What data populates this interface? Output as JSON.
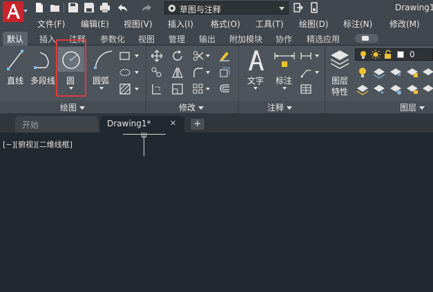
{
  "title_bar": {
    "workspace": "草图与注释",
    "document_title": "Drawing1"
  },
  "menu": {
    "items": [
      "文件(F)",
      "编辑(E)",
      "视图(V)",
      "插入(I)",
      "格式(O)",
      "工具(T)",
      "绘图(D)",
      "标注(N)",
      "修改(M)"
    ]
  },
  "ribbon_tabs": {
    "items": [
      "默认",
      "插入",
      "注释",
      "参数化",
      "视图",
      "管理",
      "输出",
      "附加模块",
      "协作",
      "精选应用"
    ],
    "active": "默认"
  },
  "draw_panel": {
    "line": "直线",
    "polyline": "多段线",
    "circle": "圆",
    "arc": "圆弧",
    "label": "绘图"
  },
  "modify_panel": {
    "label": "修改"
  },
  "annotation_panel": {
    "text": "文字",
    "dimension": "标注",
    "label": "注释"
  },
  "layers_panel": {
    "layer_properties_line1": "图层",
    "layer_properties_line2": "特性",
    "current_layer": "0",
    "label": "图层"
  },
  "file_tabs": {
    "start": "开始",
    "drawing": "Drawing1*",
    "close_glyph": "✕",
    "add_glyph": "+"
  },
  "viewport": {
    "label": "[−][俯视][二维线框]"
  },
  "colors": {
    "highlight": "#e03b3b",
    "accent_yellow": "#f2c230",
    "icon_blue": "#7fb7e6",
    "background": "#212830"
  }
}
